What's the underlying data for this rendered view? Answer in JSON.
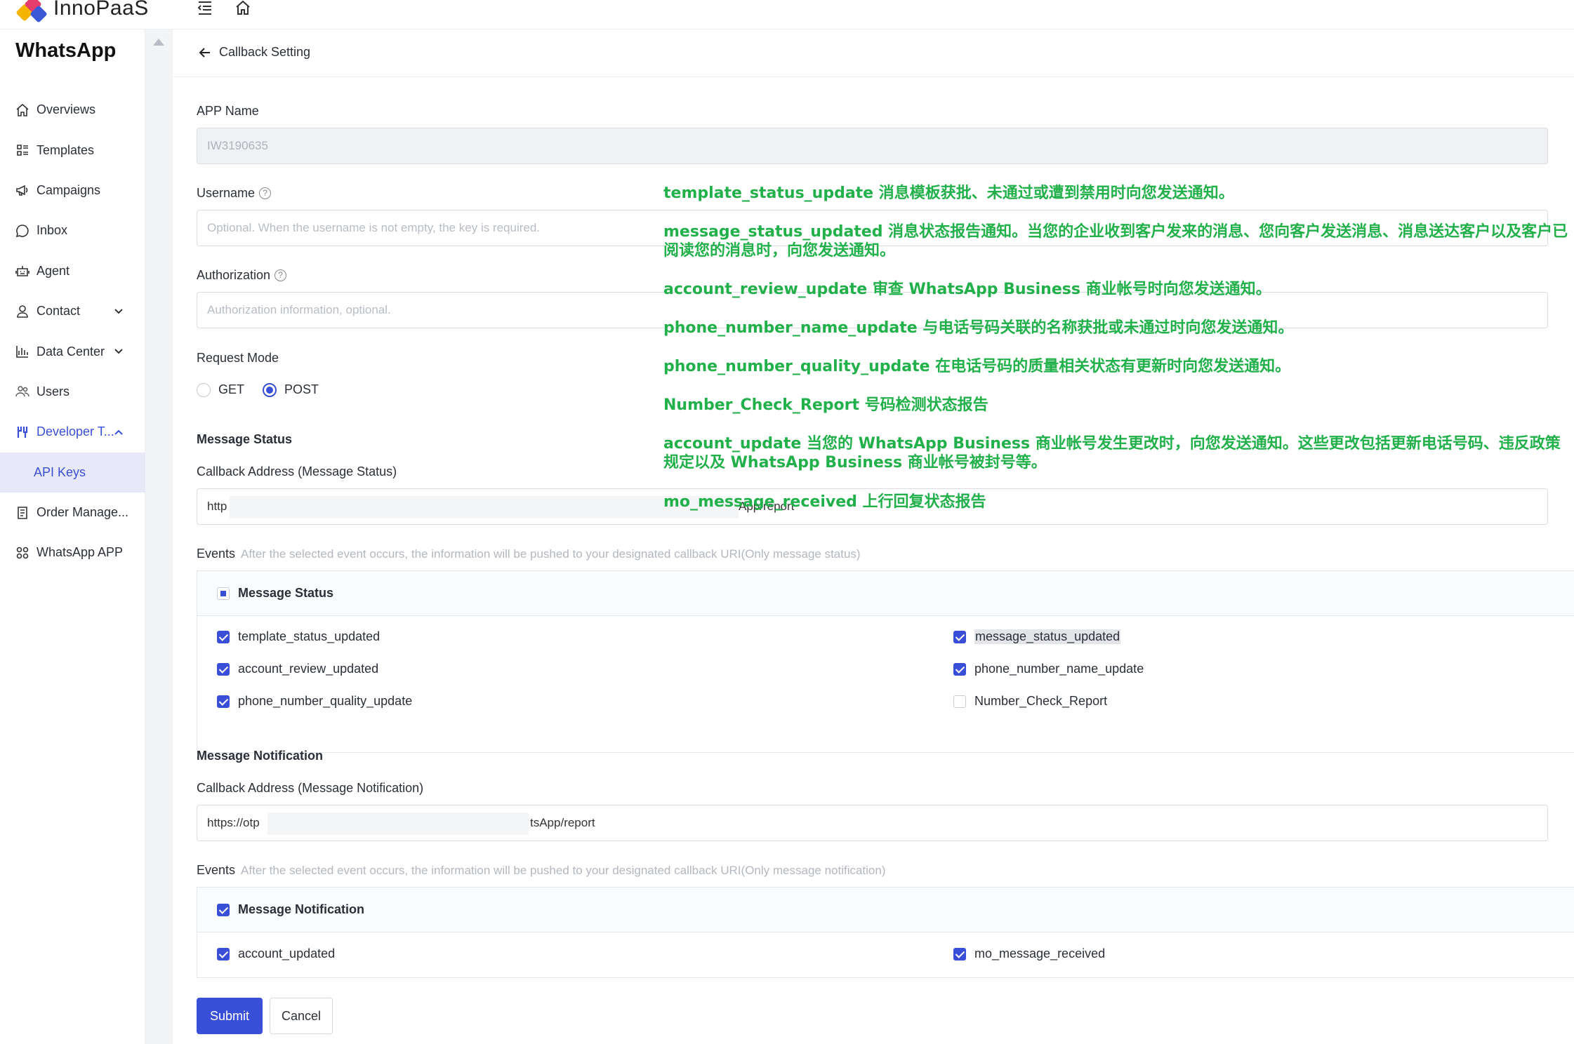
{
  "brand": {
    "name": "InnoPaaS"
  },
  "sidebar": {
    "title": "WhatsApp",
    "items": [
      {
        "label": "Overviews",
        "icon": "home-icon"
      },
      {
        "label": "Templates",
        "icon": "template-icon"
      },
      {
        "label": "Campaigns",
        "icon": "megaphone-icon"
      },
      {
        "label": "Inbox",
        "icon": "chat-icon"
      },
      {
        "label": "Agent",
        "icon": "robot-icon"
      },
      {
        "label": "Contact",
        "icon": "person-icon"
      },
      {
        "label": "Data Center",
        "icon": "bar-chart-icon"
      },
      {
        "label": "Users",
        "icon": "users-icon"
      },
      {
        "label": "Developer T...",
        "icon": "developer-icon"
      },
      {
        "label": "API Keys"
      },
      {
        "label": "Order Manage...",
        "icon": "order-icon"
      },
      {
        "label": "WhatsApp APP",
        "icon": "apps-icon"
      }
    ]
  },
  "header": {
    "back_label": "Callback Setting"
  },
  "form": {
    "app_name_label": "APP Name",
    "app_name_value": "IW3190635",
    "username_label": "Username",
    "username_placeholder": "Optional. When the username is not empty, the key is required.",
    "auth_label": "Authorization",
    "auth_placeholder": "Authorization information, optional.",
    "request_mode_label": "Request Mode",
    "request_modes": [
      "GET",
      "POST"
    ],
    "request_mode_selected": "POST",
    "help_glyph": "?"
  },
  "message_status": {
    "section_title": "Message Status",
    "callback_label": "Callback Address (Message Status)",
    "callback_prefix": "http",
    "callback_suffix": "App/report",
    "events_label": "Events",
    "events_hint": "After the selected event occurs, the information will be pushed to your designated callback URI(Only message status)",
    "group_label": "Message Status",
    "events": [
      {
        "name": "template_status_updated",
        "checked": true
      },
      {
        "name": "message_status_updated",
        "checked": true
      },
      {
        "name": "account_review_updated",
        "checked": true
      },
      {
        "name": "phone_number_name_update",
        "checked": true
      },
      {
        "name": "phone_number_quality_update",
        "checked": true
      },
      {
        "name": "Number_Check_Report",
        "checked": false
      }
    ]
  },
  "message_notification": {
    "section_title": "Message Notification",
    "callback_label": "Callback Address (Message Notification)",
    "callback_prefix": "https://otp",
    "callback_suffix": "tsApp/report",
    "events_label": "Events",
    "events_hint": "After the selected event occurs, the information will be pushed to your designated callback URI(Only message notification)",
    "group_label": "Message Notification",
    "events": [
      {
        "name": "account_updated",
        "checked": true
      },
      {
        "name": "mo_message_received",
        "checked": true
      }
    ]
  },
  "buttons": {
    "submit": "Submit",
    "cancel": "Cancel"
  },
  "annotations": [
    "template_status_update 消息模板获批、未通过或遭到禁用时向您发送通知。",
    "message_status_updated 消息状态报告通知。当您的企业收到客户发来的消息、您向客户发送消息、消息送达客户以及客户已阅读您的消息时，向您发送通知。",
    "account_review_update 审查 WhatsApp Business 商业帐号时向您发送通知。",
    "phone_number_name_update 与电话号码关联的名称获批或未通过时向您发送通知。",
    "phone_number_quality_update 在电话号码的质量相关状态有更新时向您发送通知。",
    "Number_Check_Report 号码检测状态报告",
    "account_update 当您的 WhatsApp Business 商业帐号发生更改时，向您发送通知。这些更改包括更新电话号码、违反政策规定以及 WhatsApp Business 商业帐号被封号等。",
    "mo_message_received 上行回复状态报告"
  ],
  "colors": {
    "accent": "#3a4fd8",
    "annotation": "#22b04b"
  }
}
